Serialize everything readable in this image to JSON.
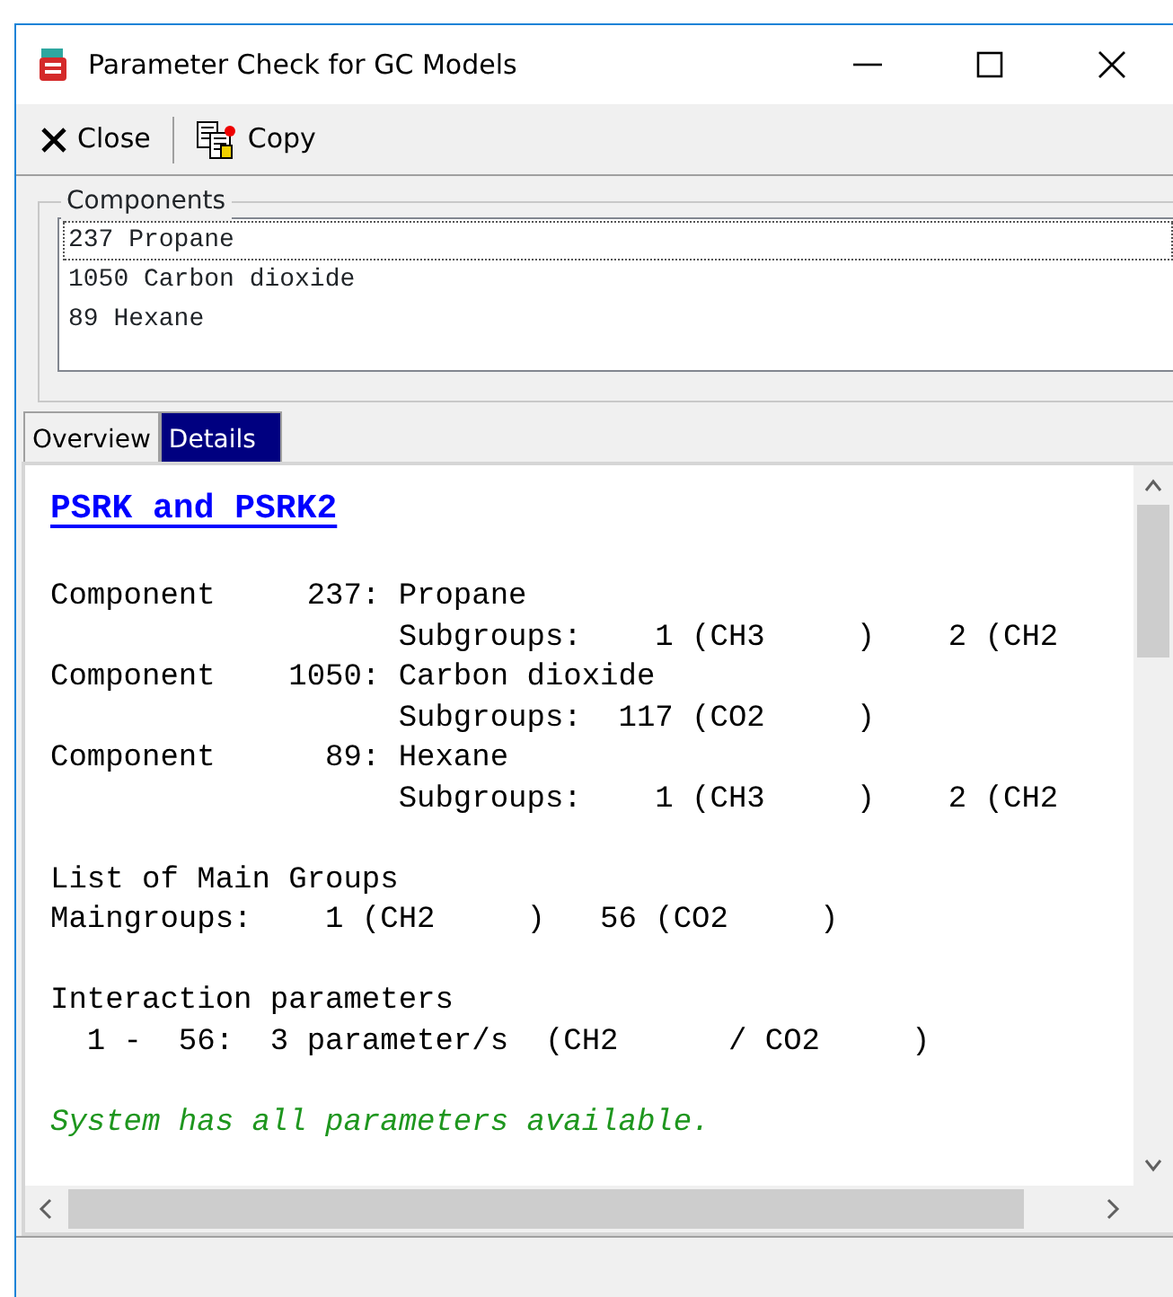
{
  "window": {
    "title": "Parameter Check for GC Models"
  },
  "toolbar": [
    {
      "label": "Close",
      "kind": "close"
    },
    {
      "label": "Copy",
      "kind": "copy"
    }
  ],
  "components": {
    "title": "Components",
    "items": [
      {
        "label": "237 Propane",
        "focused": true
      },
      {
        "label": "1050 Carbon dioxide",
        "focused": false
      },
      {
        "label": "89 Hexane",
        "focused": false
      }
    ]
  },
  "tabs": [
    {
      "label": "Overview",
      "selected": false
    },
    {
      "label": "Details",
      "selected": true
    }
  ],
  "details": {
    "heading": "PSRK and PSRK2",
    "blocks": [
      {
        "kind": "plain",
        "lines": [
          "Component     237: Propane",
          "                   Subgroups:    1 (CH3     )    2 (CH2",
          "Component    1050: Carbon dioxide",
          "                   Subgroups:  117 (CO2     )",
          "Component      89: Hexane",
          "                   Subgroups:    1 (CH3     )    2 (CH2"
        ]
      },
      {
        "kind": "plain",
        "lines": [
          "List of Main Groups",
          "Maingroups:    1 (CH2     )   56 (CO2     )"
        ]
      },
      {
        "kind": "plain",
        "lines": [
          "Interaction parameters",
          "  1 -  56:  3 parameter/s  (CH2      / CO2     )"
        ]
      },
      {
        "kind": "success",
        "lines": [
          "System has all parameters available."
        ]
      }
    ]
  }
}
